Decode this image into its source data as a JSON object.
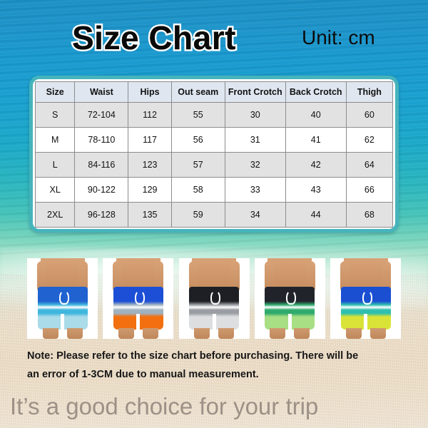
{
  "header": {
    "title": "Size Chart",
    "unit_label": "Unit: cm"
  },
  "table": {
    "columns": [
      "Size",
      "Waist",
      "Hips",
      "Out seam",
      "Front Crotch",
      "Back Crotch",
      "Thigh"
    ],
    "rows": [
      [
        "S",
        "72-104",
        "112",
        "55",
        "30",
        "40",
        "60"
      ],
      [
        "M",
        "78-110",
        "117",
        "56",
        "31",
        "41",
        "62"
      ],
      [
        "L",
        "84-116",
        "123",
        "57",
        "32",
        "42",
        "64"
      ],
      [
        "XL",
        "90-122",
        "129",
        "58",
        "33",
        "43",
        "66"
      ],
      [
        "2XL",
        "96-128",
        "135",
        "59",
        "34",
        "44",
        "68"
      ]
    ]
  },
  "photos": [
    {
      "name": "blue-stripe-shorts",
      "top_color": "#1f62d0",
      "mid_color": "#3fb6dd",
      "bottom_color": "#a9dbe8"
    },
    {
      "name": "blue-orange-shorts",
      "top_color": "#1d4fd6",
      "mid_color": "#9fb2c0",
      "bottom_color": "#f2700f"
    },
    {
      "name": "black-grey-shorts",
      "top_color": "#1d1f24",
      "mid_color": "#9a9ea3",
      "bottom_color": "#dcdee0"
    },
    {
      "name": "black-green-shorts",
      "top_color": "#20232a",
      "mid_color": "#2faa6c",
      "bottom_color": "#a8de84"
    },
    {
      "name": "blue-yellow-shorts",
      "top_color": "#1a4fd2",
      "mid_color": "#2fbfae",
      "bottom_color": "#d9e337"
    }
  ],
  "note": {
    "line1": "Note: Please refer to the size chart before purchasing. There will be",
    "line2": "an error of 1-3CM due to manual measurement."
  },
  "tagline": "It’s a good choice for your trip",
  "colors": {
    "panel_border": "#46b4bc",
    "header_row_bg": "#dfe6f0",
    "odd_row_bg": "#e2e2e2",
    "even_row_bg": "#ffffff",
    "tagline_color": "#9c9186",
    "ocean_top": "#1a8fc4",
    "sand_bottom": "#f0e6d6"
  }
}
